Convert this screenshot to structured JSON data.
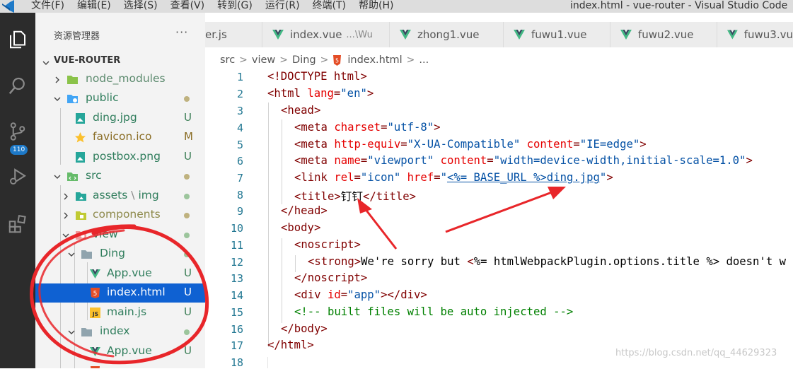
{
  "menubar": {
    "items": [
      "文件(F)",
      "编辑(E)",
      "选择(S)",
      "查看(V)",
      "转到(G)",
      "运行(R)",
      "终端(T)",
      "帮助(H)"
    ],
    "window_title": "index.html - vue-router - Visual Studio Code"
  },
  "activity_bar": {
    "items": [
      "explorer-icon",
      "search-icon",
      "source-control-icon",
      "run-debug-icon",
      "extensions-icon"
    ],
    "badge": "110"
  },
  "sidebar": {
    "header": "资源管理器",
    "more": "···",
    "root": "VUE-ROUTER",
    "tree": [
      {
        "label": "node_modules",
        "type": "folder",
        "status": "",
        "dot": false
      },
      {
        "label": "public",
        "type": "folder",
        "status": "",
        "dot": true
      },
      {
        "label": "ding.jpg",
        "type": "image",
        "status": "U"
      },
      {
        "label": "favicon.ico",
        "type": "star",
        "status": "M"
      },
      {
        "label": "postbox.png",
        "type": "image",
        "status": "U"
      },
      {
        "label": "src",
        "type": "folder",
        "status": "",
        "dot": true
      },
      {
        "label": "assets",
        "sub": "img",
        "type": "folder",
        "status": "",
        "dot": true
      },
      {
        "label": "components",
        "type": "folder",
        "status": "",
        "dot": true
      },
      {
        "label": "view",
        "type": "folder",
        "status": "",
        "dot": true
      },
      {
        "label": "Ding",
        "type": "folder",
        "status": "",
        "dot": true
      },
      {
        "label": "App.vue",
        "type": "vue",
        "status": "U"
      },
      {
        "label": "index.html",
        "type": "html",
        "status": "U"
      },
      {
        "label": "main.js",
        "type": "js",
        "status": "U"
      },
      {
        "label": "index",
        "type": "folder",
        "status": "",
        "dot": true
      },
      {
        "label": "App.vue",
        "type": "vue",
        "status": "U"
      }
    ]
  },
  "tabs": [
    {
      "label": "er.js",
      "desc": ""
    },
    {
      "label": "index.vue",
      "desc": "...\\Wu"
    },
    {
      "label": "zhong1.vue",
      "desc": ""
    },
    {
      "label": "fuwu1.vue",
      "desc": ""
    },
    {
      "label": "fuwu2.vue",
      "desc": ""
    },
    {
      "label": "fuwu3.vu",
      "desc": ""
    }
  ],
  "breadcrumb": {
    "parts": [
      "src",
      "view",
      "Ding",
      "index.html",
      "..."
    ]
  },
  "editor": {
    "line_numbers": [
      "1",
      "2",
      "3",
      "4",
      "5",
      "6",
      "7",
      "8",
      "9",
      "10",
      "11",
      "12",
      "13",
      "14",
      "15",
      "16",
      "17",
      "18"
    ],
    "lines": {
      "l1": {
        "p1": "<!DOCTYPE ",
        "t1": "html",
        "p2": ">"
      },
      "l2": {
        "p1": "<",
        "t1": "html",
        "a1": " lang",
        "p2": "=",
        "s1": "\"en\"",
        "p3": ">"
      },
      "l3": {
        "p1": "<",
        "t1": "head",
        "p2": ">"
      },
      "l4": {
        "p1": "<",
        "t1": "meta",
        "a1": " charset",
        "p2": "=",
        "s1": "\"utf-8\"",
        "p3": ">"
      },
      "l5": {
        "p1": "<",
        "t1": "meta",
        "a1": " http-equiv",
        "p2": "=",
        "s1": "\"X-UA-Compatible\"",
        "a2": " content",
        "p3": "=",
        "s2": "\"IE=edge\"",
        "p4": ">"
      },
      "l6": {
        "p1": "<",
        "t1": "meta",
        "a1": " name",
        "p2": "=",
        "s1": "\"viewport\"",
        "a2": " content",
        "p3": "=",
        "s2": "\"width=device-width,initial-scale=1.0\"",
        "p4": ">"
      },
      "l7": {
        "p1": "<",
        "t1": "link",
        "a1": " rel",
        "p2": "=",
        "s1": "\"icon\"",
        "a2": " href",
        "p3": "=",
        "s2a": "\"",
        "s2b": "<%= BASE_URL %>ding.jpg",
        "s2c": "\"",
        "p4": ">"
      },
      "l8": {
        "p1": "<",
        "t1": "title",
        "p2": ">",
        "txt": "钉钉",
        "p3": "</",
        "t2": "title",
        "p4": ">"
      },
      "l9": {
        "p1": "</",
        "t1": "head",
        "p2": ">"
      },
      "l10": {
        "p1": "<",
        "t1": "body",
        "p2": ">"
      },
      "l11": {
        "p1": "<",
        "t1": "noscript",
        "p2": ">"
      },
      "l12": {
        "p1": "<",
        "t1": "strong",
        "p2": ">",
        "txt": "We're sorry but ",
        "p3": "<",
        "txt2": "%= htmlWebpackPlugin.options.title %> doesn't w"
      },
      "l13": {
        "p1": "</",
        "t1": "noscript",
        "p2": ">"
      },
      "l14": {
        "p1": "<",
        "t1": "div",
        "a1": " id",
        "p2": "=",
        "s1": "\"app\"",
        "p3": "></",
        "t2": "div",
        "p4": ">"
      },
      "l15": {
        "c1": "<!-- built files will be auto injected -->"
      },
      "l16": {
        "p1": "</",
        "t1": "body",
        "p2": ">"
      },
      "l17": {
        "p1": "</",
        "t1": "html",
        "p2": ">"
      }
    }
  },
  "watermark": "https://blog.csdn.net/qq_44629323",
  "colors": {
    "activity_bar": "#2c2c2c",
    "sidebar": "#f3f3f3",
    "selection": "#0f61d2",
    "annotation_red": "#e8262a"
  }
}
